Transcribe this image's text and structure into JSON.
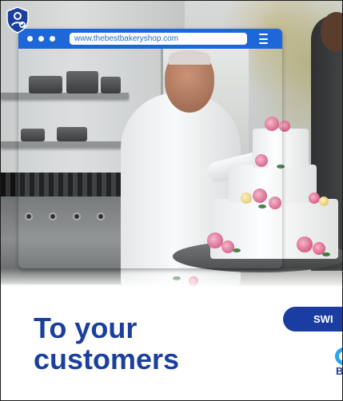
{
  "browser": {
    "url": "www.thebestbakeryshop.com",
    "accent_color": "#1e67d8",
    "menu_icon": "hamburger-menu-icon",
    "window_dots": 3
  },
  "badge": {
    "icon": "shield-check-icon",
    "color": "#1a3f9c"
  },
  "headline": {
    "line1": "To your",
    "line2": "customers",
    "color": "#1a3f9c"
  },
  "pill": {
    "label": "SWI",
    "color": "#1b3da2"
  },
  "logo": {
    "letter": "B",
    "ring_color": "#2aa5f0"
  }
}
